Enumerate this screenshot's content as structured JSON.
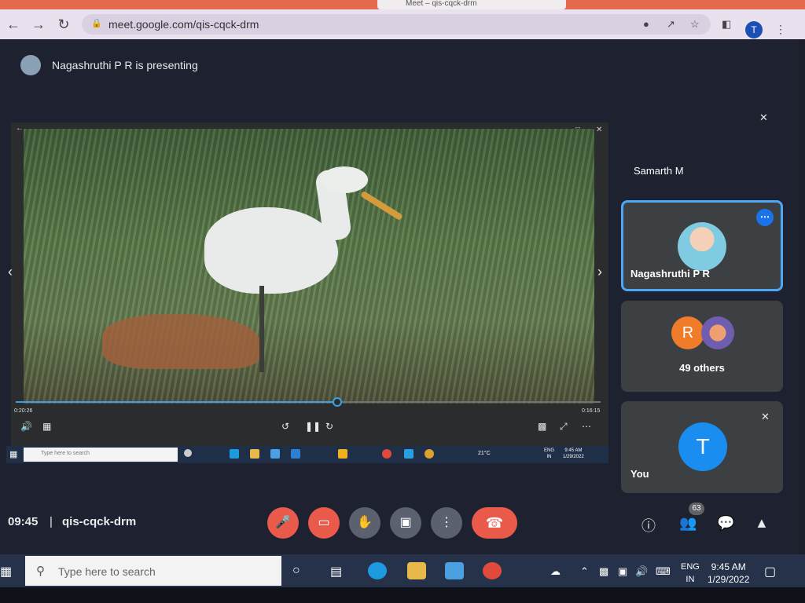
{
  "browser": {
    "tab_title": "Meet – qis-cqck-drm",
    "url": "meet.google.com/qis-cqck-drm",
    "profile_initial": "T"
  },
  "meet": {
    "presenting_text": "Nagashruthi P R is presenting",
    "time": "09:45",
    "separator": "|",
    "meeting_code": "qis-cqck-drm",
    "participant_count": "63"
  },
  "video": {
    "elapsed": "0:20:26",
    "duration": "0:16:15",
    "progress_fraction": 0.55
  },
  "mini_taskbar": {
    "search_placeholder": "Type here to search",
    "temperature": "21°C",
    "lang": "ENG",
    "region": "IN",
    "time": "9:45 AM",
    "date": "1/29/2022"
  },
  "tiles": {
    "samarth": {
      "name": "Samarth M"
    },
    "presenter": {
      "name": "Nagashruthi P R"
    },
    "others": {
      "initial": "R",
      "label": "49 others"
    },
    "you": {
      "initial": "T",
      "name": "You"
    }
  },
  "taskbar": {
    "search_placeholder": "Type here to search",
    "lang": "ENG",
    "region": "IN",
    "time": "9:45 AM",
    "date": "1/29/2022"
  },
  "colors": {
    "accent_blue": "#1a73e8",
    "end_call_red": "#ea5a4a",
    "tile_bg": "#3c4043"
  }
}
